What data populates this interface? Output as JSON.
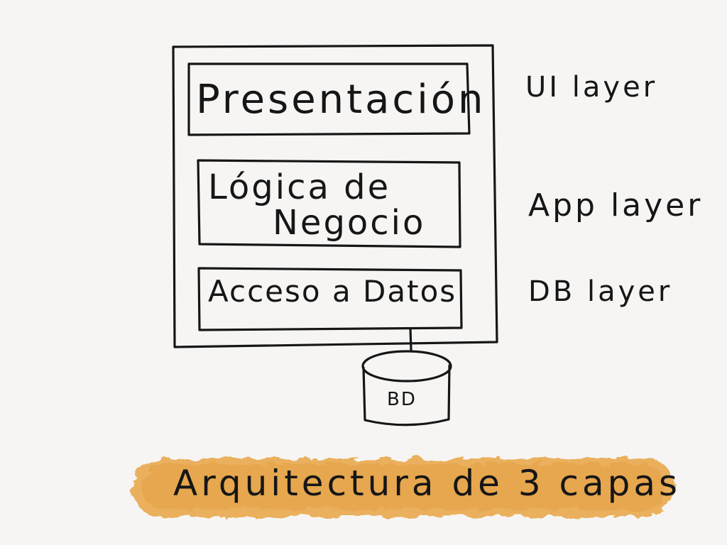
{
  "diagram": {
    "layers": [
      {
        "label_lines": [
          "Presentación"
        ],
        "side_label": "UI layer"
      },
      {
        "label_lines": [
          "Lógica de",
          "Negocio"
        ],
        "side_label": "App layer"
      },
      {
        "label_lines": [
          "Acceso a Datos"
        ],
        "side_label": "DB layer"
      }
    ],
    "database": {
      "label": "BD"
    },
    "banner": {
      "text": "Arquitectura de 3 capas",
      "color": "#e9a74a"
    }
  }
}
